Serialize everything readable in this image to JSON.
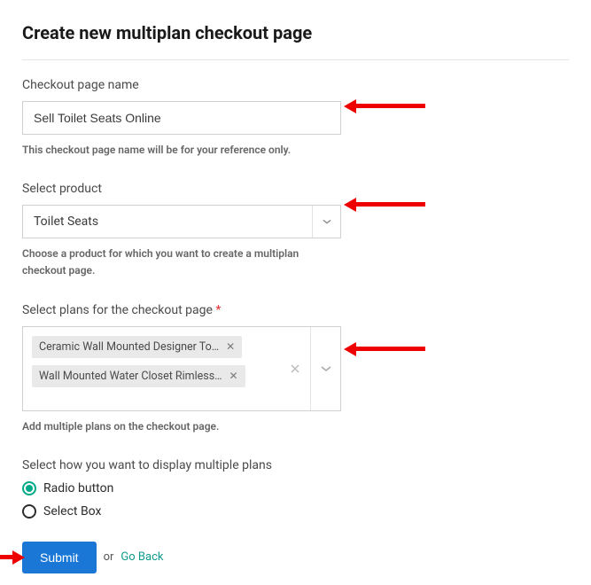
{
  "page_title": "Create new multiplan checkout page",
  "checkout_name": {
    "label": "Checkout page name",
    "value": "Sell Toilet Seats Online",
    "helper": "This checkout page name will be for your reference only."
  },
  "product": {
    "label": "Select product",
    "value": "Toilet Seats",
    "helper": "Choose a product for which you want to create a multiplan checkout page."
  },
  "plans": {
    "label": "Select plans for the checkout page",
    "required_mark": "*",
    "tags": [
      "Ceramic Wall Mounted Designer To…",
      "Wall Mounted Water Closet Rimless…"
    ],
    "helper": "Add multiple plans on the checkout page."
  },
  "display": {
    "label": "Select how you want to display multiple plans",
    "options": [
      {
        "label": "Radio button",
        "selected": true
      },
      {
        "label": "Select Box",
        "selected": false
      }
    ]
  },
  "actions": {
    "submit": "Submit",
    "or": "or",
    "goback": "Go Back"
  }
}
